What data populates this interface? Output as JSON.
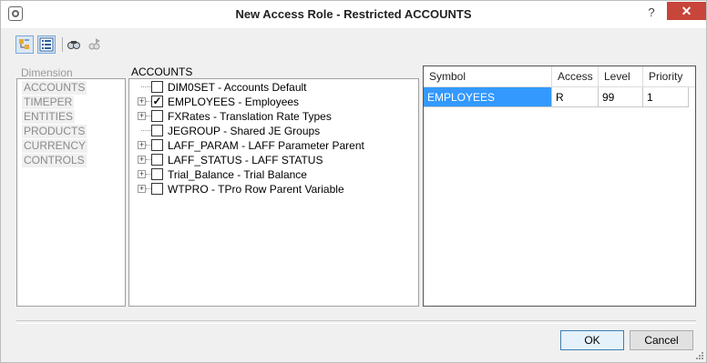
{
  "window": {
    "title": "New Access Role - Restricted ACCOUNTS",
    "help_label": "?",
    "close_label": "✕"
  },
  "toolbar": {
    "buttons": [
      {
        "name": "tree-view-icon",
        "selected": true
      },
      {
        "name": "list-view-icon",
        "selected": false
      },
      {
        "name": "find-icon",
        "selected": false
      },
      {
        "name": "find-next-icon",
        "selected": false
      }
    ]
  },
  "dimension": {
    "label": "Dimension",
    "items": [
      "ACCOUNTS",
      "TIMEPER",
      "ENTITIES",
      "PRODUCTS",
      "CURRENCY",
      "CONTROLS"
    ]
  },
  "accounts": {
    "label": "ACCOUNTS",
    "nodes": [
      {
        "text": "DIM0SET - Accounts Default",
        "expandable": false,
        "checked": false
      },
      {
        "text": "EMPLOYEES - Employees",
        "expandable": true,
        "checked": true
      },
      {
        "text": "FXRates - Translation Rate Types",
        "expandable": true,
        "checked": false
      },
      {
        "text": "JEGROUP - Shared JE Groups",
        "expandable": false,
        "checked": false
      },
      {
        "text": "LAFF_PARAM - LAFF Parameter Parent",
        "expandable": true,
        "checked": false
      },
      {
        "text": "LAFF_STATUS - LAFF STATUS",
        "expandable": true,
        "checked": false
      },
      {
        "text": "Trial_Balance - Trial Balance",
        "expandable": true,
        "checked": false
      },
      {
        "text": "WTPRO - TPro Row Parent Variable",
        "expandable": true,
        "checked": false
      }
    ]
  },
  "grid": {
    "columns": [
      "Symbol",
      "Access",
      "Level",
      "Priority"
    ],
    "rows": [
      {
        "symbol": "EMPLOYEES",
        "access": "R",
        "level": "99",
        "priority": "1"
      }
    ]
  },
  "buttons": {
    "ok": "OK",
    "cancel": "Cancel"
  },
  "colors": {
    "selection": "#3399ff",
    "close": "#c7453a"
  }
}
